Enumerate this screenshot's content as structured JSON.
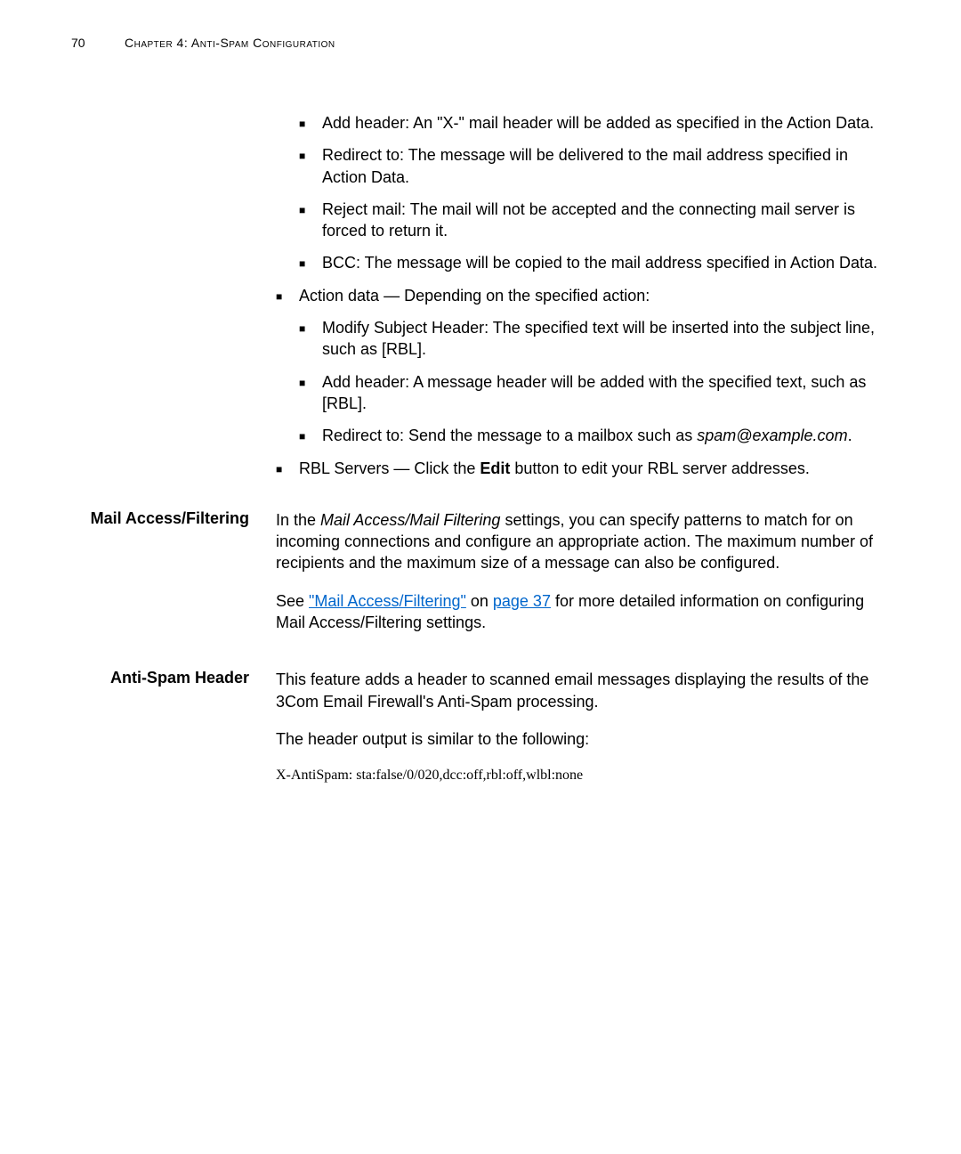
{
  "page_number": "70",
  "chapter_title": "Chapter 4: Anti-Spam Configuration",
  "bullets_l2_a": [
    "Add header: An \"X-\" mail header will be added as specified in the Action Data.",
    "Redirect to: The message will be delivered to the mail address specified in Action Data.",
    "Reject mail: The mail will not be accepted and the connecting mail server is forced to return it.",
    "BCC: The message will be copied to the mail address specified in Action Data."
  ],
  "bullet_action_data": "Action data — Depending on the specified action:",
  "bullets_l2_b": [
    "Modify Subject Header: The specified text will be inserted into the subject line, such as [RBL].",
    "Add header: A message header will be added with the specified text, such as [RBL]."
  ],
  "redirect_prefix": "Redirect to: Send the message to a mailbox such as ",
  "redirect_italic": "spam@example.com",
  "redirect_suffix": ".",
  "rbl_prefix": "RBL Servers — Click the ",
  "rbl_bold": "Edit",
  "rbl_suffix": " button to edit your RBL server addresses.",
  "section_mail_access": {
    "label": "Mail Access/Filtering",
    "para1_prefix": "In the ",
    "para1_italic": "Mail Access/Mail Filtering",
    "para1_suffix": " settings, you can specify patterns to match for on incoming connections and configure an appropriate action. The maximum number of recipients and the maximum size of a message can also be configured.",
    "para2_prefix": "See ",
    "para2_link1": "\"Mail Access/Filtering\"",
    "para2_mid": " on ",
    "para2_link2": "page 37",
    "para2_suffix": " for more detailed information on configuring Mail Access/Filtering settings."
  },
  "section_antispam": {
    "label": "Anti-Spam Header",
    "para1": "This feature adds a header to scanned email messages displaying the results of the 3Com Email Firewall's Anti-Spam processing.",
    "para2": "The header output is similar to the following:",
    "code": "X-AntiSpam: sta:false/0/020,dcc:off,rbl:off,wlbl:none"
  }
}
